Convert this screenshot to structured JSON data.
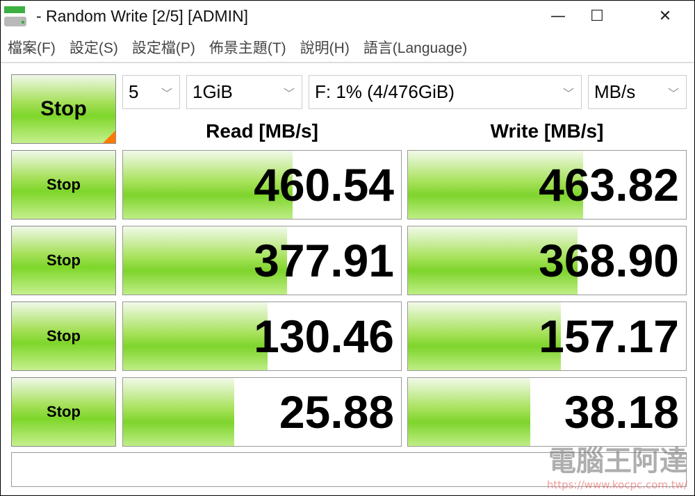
{
  "window": {
    "title": "- Random Write [2/5] [ADMIN]",
    "minimize": "—",
    "maximize": "☐",
    "close": "✕"
  },
  "menu": [
    "檔案(F)",
    "設定(S)",
    "設定檔(P)",
    "佈景主題(T)",
    "說明(H)",
    "語言(Language)"
  ],
  "controls": {
    "main_button": "Stop",
    "count": "5",
    "size": "1GiB",
    "drive": "F: 1% (4/476GiB)",
    "unit": "MB/s"
  },
  "headers": {
    "read": "Read [MB/s]",
    "write": "Write [MB/s]"
  },
  "rows": [
    {
      "button": "Stop",
      "read": "460.54",
      "read_fill": 0.61,
      "write": "463.82",
      "write_fill": 0.63
    },
    {
      "button": "Stop",
      "read": "377.91",
      "read_fill": 0.59,
      "write": "368.90",
      "write_fill": 0.61
    },
    {
      "button": "Stop",
      "read": "130.46",
      "read_fill": 0.52,
      "write": "157.17",
      "write_fill": 0.55
    },
    {
      "button": "Stop",
      "read": "25.88",
      "read_fill": 0.4,
      "write": "38.18",
      "write_fill": 0.44
    }
  ],
  "status": "",
  "watermark": {
    "name": "電腦王阿達",
    "url": "https://www.kocpc.com.tw/"
  }
}
